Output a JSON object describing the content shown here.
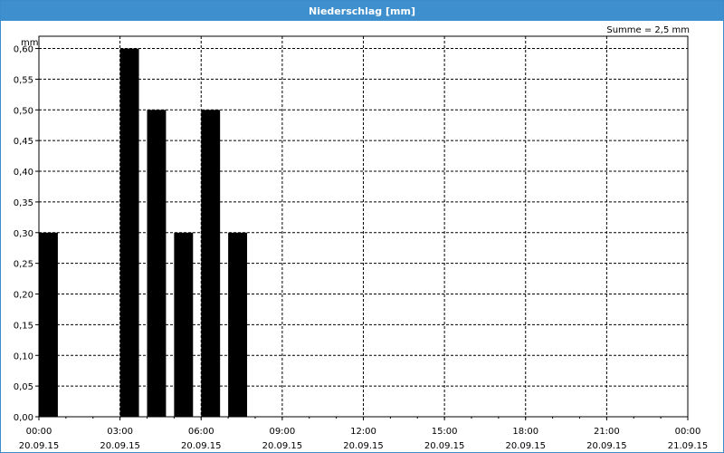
{
  "window": {
    "title": "Niederschlag [mm]"
  },
  "summary": {
    "text": "Summe = 2,5 mm"
  },
  "colors": {
    "titlebar": "#3d8fcd",
    "bar": "#000000",
    "grid": "#000000"
  },
  "chart_data": {
    "type": "bar",
    "title": "Niederschlag [mm]",
    "ylabel": "mm",
    "ylim": [
      0,
      0.62
    ],
    "grid": true,
    "x": [
      "20.09.15 00:00",
      "20.09.15 03:00",
      "20.09.15 04:00",
      "20.09.15 05:00",
      "20.09.15 06:00",
      "20.09.15 07:00"
    ],
    "values": [
      0.3,
      0.6,
      0.5,
      0.3,
      0.5,
      0.3
    ],
    "y_ticks": [
      "0,00",
      "0,05",
      "0,10",
      "0,15",
      "0,20",
      "0,25",
      "0,30",
      "0,35",
      "0,40",
      "0,45",
      "0,50",
      "0,55",
      "0,60"
    ],
    "x_ticks": [
      {
        "time": "00:00",
        "date": "20.09.15"
      },
      {
        "time": "03:00",
        "date": "20.09.15"
      },
      {
        "time": "06:00",
        "date": "20.09.15"
      },
      {
        "time": "09:00",
        "date": "20.09.15"
      },
      {
        "time": "12:00",
        "date": "20.09.15"
      },
      {
        "time": "15:00",
        "date": "20.09.15"
      },
      {
        "time": "18:00",
        "date": "20.09.15"
      },
      {
        "time": "21:00",
        "date": "20.09.15"
      },
      {
        "time": "00:00",
        "date": "21.09.15"
      }
    ]
  }
}
